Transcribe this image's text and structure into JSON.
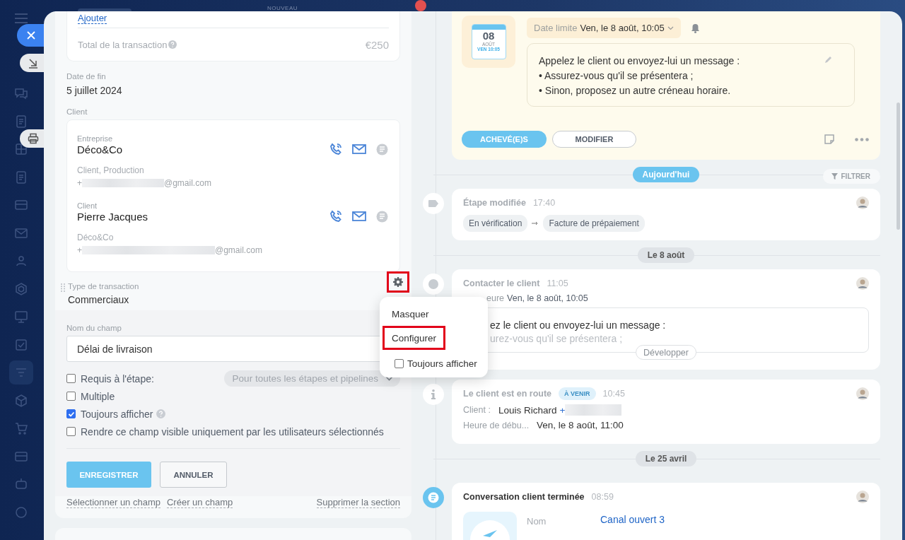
{
  "top_bar": {
    "label": "NOUVEAU"
  },
  "left": {
    "add_link": "Ajouter",
    "total": {
      "label": "Total de la transaction",
      "value": "€250"
    },
    "end_date": {
      "label": "Date de fin",
      "value": "5 juillet 2024"
    },
    "client_label": "Client",
    "contacts": [
      {
        "type_label": "Entreprise",
        "name": "Déco&Co",
        "subtitle": "Client, Production",
        "phone_prefix": "+",
        "email_suffix": "@gmail.com"
      },
      {
        "type_label": "Client",
        "name": "Pierre Jacques",
        "subtitle": "Déco&Co",
        "phone_prefix": "+",
        "email_suffix": "@gmail.com"
      }
    ],
    "transaction_type": {
      "label": "Type de transaction",
      "value": "Commerciaux",
      "gear_highlighted": true
    },
    "editor": {
      "name_label": "Nom du champ",
      "name_value": "Délai de livraison",
      "options": [
        {
          "label": "Requis à l'étape:",
          "checked": false,
          "help": false
        },
        {
          "label": "Multiple",
          "checked": false,
          "help": false
        },
        {
          "label": "Toujours afficher",
          "checked": true,
          "help": true
        },
        {
          "label": "Rendre ce champ visible uniquement par les utilisateurs sélectionnés",
          "checked": false,
          "help": false
        }
      ],
      "stage_select": "Pour toutes les étapes et pipelines",
      "buttons": [
        {
          "label": "ENREGISTRER",
          "kind": "primary"
        },
        {
          "label": "ANNULER",
          "kind": "secondary"
        }
      ],
      "links": [
        "Sélectionner un champ",
        "Créer un champ",
        "Supprimer la section"
      ]
    }
  },
  "menu": {
    "items": [
      {
        "label": "Masquer",
        "kind": "item",
        "highlighted": false
      },
      {
        "label": "Configurer",
        "kind": "item",
        "highlighted": true
      },
      {
        "label": "Toujours afficher",
        "kind": "checkbox",
        "checked": false
      }
    ]
  },
  "timeline": {
    "activity": {
      "calendar": {
        "day": "08",
        "month": "AOÛT",
        "time": "VEN 10:05"
      },
      "deadline_label": "Date limite",
      "deadline_value": "Ven, le 8 août, 10:05",
      "lines": [
        "Appelez le client ou envoyez-lui un message :",
        "• Assurez-vous qu'il se présentera ;",
        "• Sinon, proposez un autre créneau horaire."
      ],
      "buttons": [
        {
          "label": "ACHEVÉ(E)S",
          "kind": "primary"
        },
        {
          "label": "MODIFIER",
          "kind": "secondary"
        }
      ]
    },
    "filter": "FILTRER",
    "entries": [
      {
        "kind": "today",
        "label": "Aujourd'hui"
      },
      {
        "kind": "stage",
        "title": "Étape modifiée",
        "time": "17:40",
        "from": "En vérification",
        "to": "Facture de prépaiement"
      },
      {
        "kind": "date",
        "label": "Le 8 août"
      },
      {
        "kind": "task",
        "title": "Contacter le client",
        "time": "11:05",
        "deadline_label": "eure",
        "deadline_value": "Ven, le 8 août, 10:05",
        "lines": [
          "ez le client ou envoyez-lui un message :",
          "urez-vous qu'il se présentera ;"
        ],
        "expand": "Développer"
      },
      {
        "kind": "info",
        "title": "Le client est en route",
        "badge": "À VENIR",
        "time": "10:45",
        "rows": [
          {
            "label": "Client :",
            "value": "Louis Richard",
            "phone": "+"
          },
          {
            "label": "Heure de débu...",
            "value": "Ven, le 8 août, 11:00"
          }
        ]
      },
      {
        "kind": "date",
        "label": "Le 25 avril"
      },
      {
        "kind": "chat",
        "title": "Conversation client terminée",
        "time": "08:59",
        "field_label": "Nom",
        "field_value": "Canal ouvert 3"
      }
    ]
  }
}
